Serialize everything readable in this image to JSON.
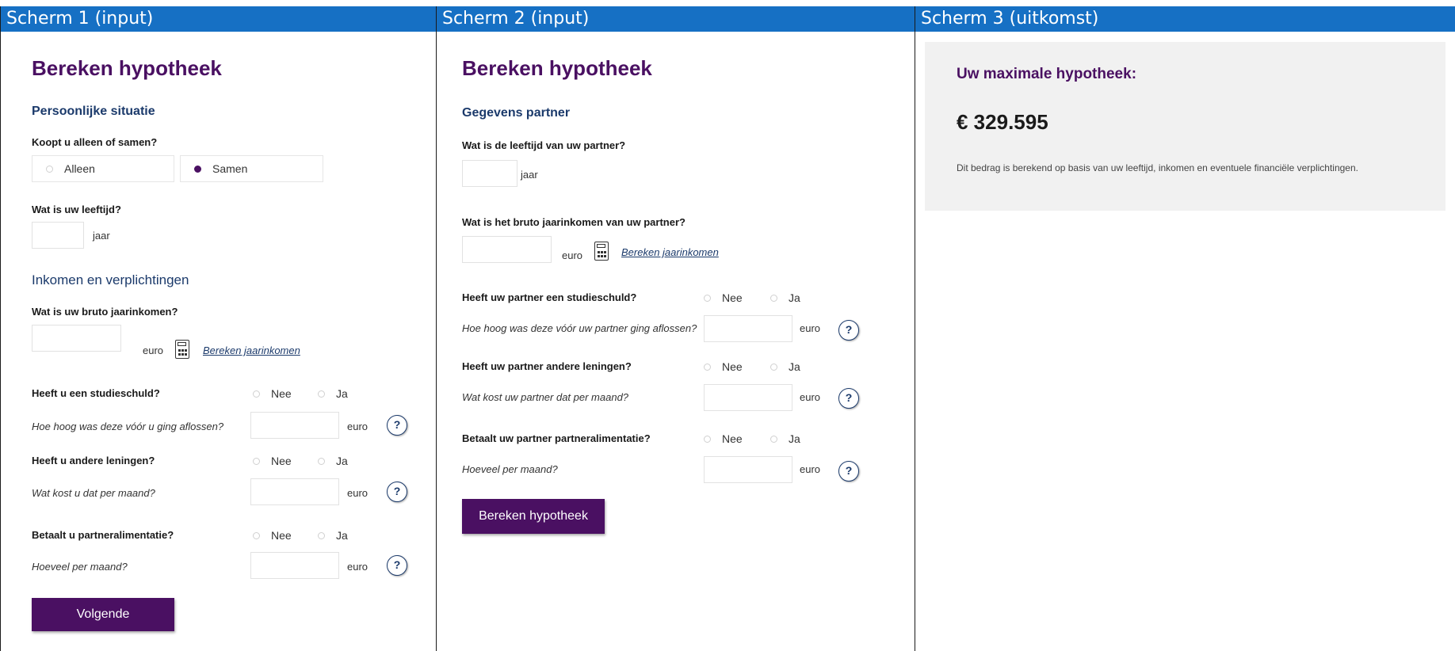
{
  "screens": [
    {
      "header": "Scherm 1 (input)"
    },
    {
      "header": "Scherm 2 (input)"
    },
    {
      "header": "Scherm 3 (uitkomst)"
    }
  ],
  "screen1": {
    "title": "Bereken hypotheek",
    "section_personal": "Persoonlijke situatie",
    "q_alone": "Koopt u alleen of samen?",
    "opt_alone": "Alleen",
    "opt_together": "Samen",
    "selected": "Samen",
    "q_age": "Wat is uw leeftijd?",
    "unit_year": "jaar",
    "section_income": "Inkomen en verplichtingen",
    "q_income": "Wat is uw bruto jaarinkomen?",
    "unit_euro": "euro",
    "link_income": "Bereken jaarinkomen",
    "q_study": "Heeft u een studieschuld?",
    "sub_study": "Hoe hoog was deze vóór u ging aflossen?",
    "q_loans": "Heeft u andere leningen?",
    "sub_loans": "Wat kost u dat per maand?",
    "q_alimony": "Betaalt u partneralimentatie?",
    "sub_alimony": "Hoeveel per maand?",
    "no": "Nee",
    "yes": "Ja",
    "help": "?",
    "next_button": "Volgende"
  },
  "screen2": {
    "title": "Bereken hypotheek",
    "section_partner": "Gegevens partner",
    "q_age": "Wat is de leeftijd van uw partner?",
    "unit_year": "jaar",
    "q_income": "Wat is het bruto jaarinkomen van uw partner?",
    "unit_euro": "euro",
    "link_income": "Bereken jaarinkomen",
    "q_study": "Heeft uw partner een studieschuld?",
    "sub_study": "Hoe hoog was deze vóór uw partner ging aflossen?",
    "q_loans": "Heeft uw partner andere leningen?",
    "sub_loans": "Wat kost uw partner dat per maand?",
    "q_alimony": "Betaalt uw partner partneralimentatie?",
    "sub_alimony": "Hoeveel per maand?",
    "no": "Nee",
    "yes": "Ja",
    "help": "?",
    "calc_button": "Bereken hypotheek"
  },
  "screen3": {
    "title": "Uw maximale hypotheek:",
    "amount": "€ 329.595",
    "explanation": "Dit bedrag is berekend op basis van uw leeftijd, inkomen en eventuele financiële verplichtingen."
  },
  "colors": {
    "header_blue": "#1670c4",
    "brand_purple": "#4a1062",
    "navy": "#1b3a6b",
    "result_bg": "#f1f1f1"
  },
  "icons": [
    "calculator-icon",
    "help-icon",
    "radio-icon"
  ]
}
